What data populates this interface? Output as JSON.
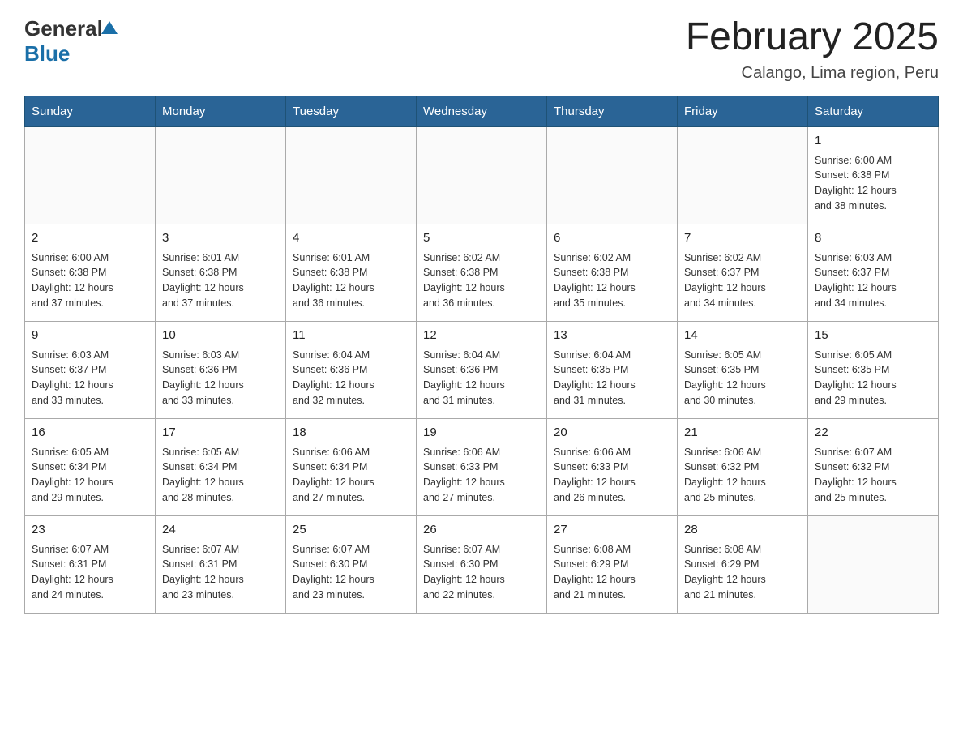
{
  "logo": {
    "general": "General",
    "blue": "Blue"
  },
  "header": {
    "month_year": "February 2025",
    "location": "Calango, Lima region, Peru"
  },
  "weekdays": [
    "Sunday",
    "Monday",
    "Tuesday",
    "Wednesday",
    "Thursday",
    "Friday",
    "Saturday"
  ],
  "weeks": [
    [
      {
        "day": "",
        "info": ""
      },
      {
        "day": "",
        "info": ""
      },
      {
        "day": "",
        "info": ""
      },
      {
        "day": "",
        "info": ""
      },
      {
        "day": "",
        "info": ""
      },
      {
        "day": "",
        "info": ""
      },
      {
        "day": "1",
        "info": "Sunrise: 6:00 AM\nSunset: 6:38 PM\nDaylight: 12 hours\nand 38 minutes."
      }
    ],
    [
      {
        "day": "2",
        "info": "Sunrise: 6:00 AM\nSunset: 6:38 PM\nDaylight: 12 hours\nand 37 minutes."
      },
      {
        "day": "3",
        "info": "Sunrise: 6:01 AM\nSunset: 6:38 PM\nDaylight: 12 hours\nand 37 minutes."
      },
      {
        "day": "4",
        "info": "Sunrise: 6:01 AM\nSunset: 6:38 PM\nDaylight: 12 hours\nand 36 minutes."
      },
      {
        "day": "5",
        "info": "Sunrise: 6:02 AM\nSunset: 6:38 PM\nDaylight: 12 hours\nand 36 minutes."
      },
      {
        "day": "6",
        "info": "Sunrise: 6:02 AM\nSunset: 6:38 PM\nDaylight: 12 hours\nand 35 minutes."
      },
      {
        "day": "7",
        "info": "Sunrise: 6:02 AM\nSunset: 6:37 PM\nDaylight: 12 hours\nand 34 minutes."
      },
      {
        "day": "8",
        "info": "Sunrise: 6:03 AM\nSunset: 6:37 PM\nDaylight: 12 hours\nand 34 minutes."
      }
    ],
    [
      {
        "day": "9",
        "info": "Sunrise: 6:03 AM\nSunset: 6:37 PM\nDaylight: 12 hours\nand 33 minutes."
      },
      {
        "day": "10",
        "info": "Sunrise: 6:03 AM\nSunset: 6:36 PM\nDaylight: 12 hours\nand 33 minutes."
      },
      {
        "day": "11",
        "info": "Sunrise: 6:04 AM\nSunset: 6:36 PM\nDaylight: 12 hours\nand 32 minutes."
      },
      {
        "day": "12",
        "info": "Sunrise: 6:04 AM\nSunset: 6:36 PM\nDaylight: 12 hours\nand 31 minutes."
      },
      {
        "day": "13",
        "info": "Sunrise: 6:04 AM\nSunset: 6:35 PM\nDaylight: 12 hours\nand 31 minutes."
      },
      {
        "day": "14",
        "info": "Sunrise: 6:05 AM\nSunset: 6:35 PM\nDaylight: 12 hours\nand 30 minutes."
      },
      {
        "day": "15",
        "info": "Sunrise: 6:05 AM\nSunset: 6:35 PM\nDaylight: 12 hours\nand 29 minutes."
      }
    ],
    [
      {
        "day": "16",
        "info": "Sunrise: 6:05 AM\nSunset: 6:34 PM\nDaylight: 12 hours\nand 29 minutes."
      },
      {
        "day": "17",
        "info": "Sunrise: 6:05 AM\nSunset: 6:34 PM\nDaylight: 12 hours\nand 28 minutes."
      },
      {
        "day": "18",
        "info": "Sunrise: 6:06 AM\nSunset: 6:34 PM\nDaylight: 12 hours\nand 27 minutes."
      },
      {
        "day": "19",
        "info": "Sunrise: 6:06 AM\nSunset: 6:33 PM\nDaylight: 12 hours\nand 27 minutes."
      },
      {
        "day": "20",
        "info": "Sunrise: 6:06 AM\nSunset: 6:33 PM\nDaylight: 12 hours\nand 26 minutes."
      },
      {
        "day": "21",
        "info": "Sunrise: 6:06 AM\nSunset: 6:32 PM\nDaylight: 12 hours\nand 25 minutes."
      },
      {
        "day": "22",
        "info": "Sunrise: 6:07 AM\nSunset: 6:32 PM\nDaylight: 12 hours\nand 25 minutes."
      }
    ],
    [
      {
        "day": "23",
        "info": "Sunrise: 6:07 AM\nSunset: 6:31 PM\nDaylight: 12 hours\nand 24 minutes."
      },
      {
        "day": "24",
        "info": "Sunrise: 6:07 AM\nSunset: 6:31 PM\nDaylight: 12 hours\nand 23 minutes."
      },
      {
        "day": "25",
        "info": "Sunrise: 6:07 AM\nSunset: 6:30 PM\nDaylight: 12 hours\nand 23 minutes."
      },
      {
        "day": "26",
        "info": "Sunrise: 6:07 AM\nSunset: 6:30 PM\nDaylight: 12 hours\nand 22 minutes."
      },
      {
        "day": "27",
        "info": "Sunrise: 6:08 AM\nSunset: 6:29 PM\nDaylight: 12 hours\nand 21 minutes."
      },
      {
        "day": "28",
        "info": "Sunrise: 6:08 AM\nSunset: 6:29 PM\nDaylight: 12 hours\nand 21 minutes."
      },
      {
        "day": "",
        "info": ""
      }
    ]
  ]
}
